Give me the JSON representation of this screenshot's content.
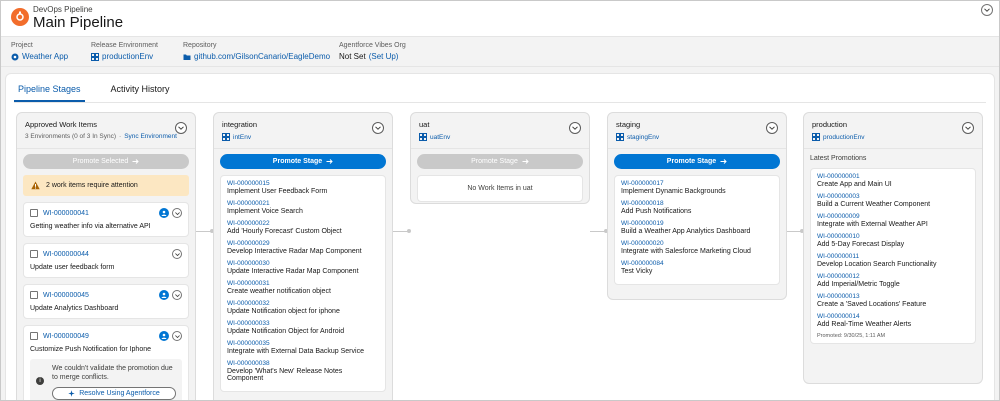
{
  "header": {
    "eyebrow": "DevOps Pipeline",
    "title": "Main Pipeline"
  },
  "info": {
    "project": {
      "label": "Project",
      "value": "Weather App"
    },
    "release_env": {
      "label": "Release Environment",
      "value": "productionEnv"
    },
    "repository": {
      "label": "Repository",
      "value": "github.com/GilsonCanario/EagleDemo"
    },
    "vibes_org": {
      "label": "Agentforce Vibes Org",
      "value": "Not Set",
      "link": "(Set Up)"
    }
  },
  "tabs": [
    "Pipeline Stages",
    "Activity History"
  ],
  "approved": {
    "title": "Approved Work Items",
    "status": "3 Environments (0 of 3 In Sync)",
    "sep": "·",
    "sync": "Sync Environment",
    "promote_label": "Promote Selected",
    "warning": "2 work items require attention",
    "items": [
      {
        "id": "WI-000000041",
        "name": "Getting weather info via alternative API"
      },
      {
        "id": "WI-000000044",
        "name": "Update user feedback form"
      },
      {
        "id": "WI-000000045",
        "name": "Update Analytics Dashboard"
      },
      {
        "id": "WI-000000049",
        "name": "Customize Push Notification for Iphone"
      }
    ],
    "alert": "We couldn't validate the promotion due to merge conflicts.",
    "resolve_label": "Resolve Using Agentforce"
  },
  "integration": {
    "title": "integration",
    "env": "intEnv",
    "promote_label": "Promote Stage",
    "items": [
      {
        "id": "WI-000000015",
        "name": "Implement User Feedback Form"
      },
      {
        "id": "WI-000000021",
        "name": "Implement Voice Search"
      },
      {
        "id": "WI-000000022",
        "name": "Add 'Hourly Forecast' Custom Object"
      },
      {
        "id": "WI-000000029",
        "name": "Develop Interactive Radar Map Component"
      },
      {
        "id": "WI-000000030",
        "name": "Update Interactive Radar Map Component"
      },
      {
        "id": "WI-000000031",
        "name": "Create weather notification object"
      },
      {
        "id": "WI-000000032",
        "name": "Update Notification object for iphone"
      },
      {
        "id": "WI-000000033",
        "name": "Update Notification Object for Android"
      },
      {
        "id": "WI-000000035",
        "name": "Integrate with External Data Backup Service"
      },
      {
        "id": "WI-000000038",
        "name": "Develop 'What's New' Release Notes Component"
      }
    ]
  },
  "uat": {
    "title": "uat",
    "env": "uatEnv",
    "promote_label": "Promote Stage",
    "empty": "No Work Items in uat"
  },
  "staging": {
    "title": "staging",
    "env": "stagingEnv",
    "promote_label": "Promote Stage",
    "items": [
      {
        "id": "WI-000000017",
        "name": "Implement Dynamic Backgrounds"
      },
      {
        "id": "WI-000000018",
        "name": "Add Push Notifications"
      },
      {
        "id": "WI-000000019",
        "name": "Build a Weather App Analytics Dashboard"
      },
      {
        "id": "WI-000000020",
        "name": "Integrate with Salesforce Marketing Cloud"
      },
      {
        "id": "WI-000000084",
        "name": "Test Vicky"
      }
    ]
  },
  "production": {
    "title": "production",
    "env": "productionEnv",
    "latest_label": "Latest Promotions",
    "items": [
      {
        "id": "WI-000000001",
        "name": "Create App and Main UI"
      },
      {
        "id": "WI-000000003",
        "name": "Build a Current Weather Component"
      },
      {
        "id": "WI-000000009",
        "name": "Integrate with External Weather API"
      },
      {
        "id": "WI-000000010",
        "name": "Add 5-Day Forecast Display"
      },
      {
        "id": "WI-000000011",
        "name": "Develop Location Search Functionality"
      },
      {
        "id": "WI-000000012",
        "name": "Add Imperial/Metric Toggle"
      },
      {
        "id": "WI-000000013",
        "name": "Create a 'Saved Locations' Feature"
      },
      {
        "id": "WI-000000014",
        "name": "Add Real-Time Weather Alerts"
      }
    ],
    "promoted": "Promoted: 9/30/25, 1:11 AM"
  },
  "colors": {
    "brand": "#f26d2b",
    "link": "#0b5cab",
    "primary_button": "#0176d3",
    "warning_bg": "#fce7c2"
  }
}
